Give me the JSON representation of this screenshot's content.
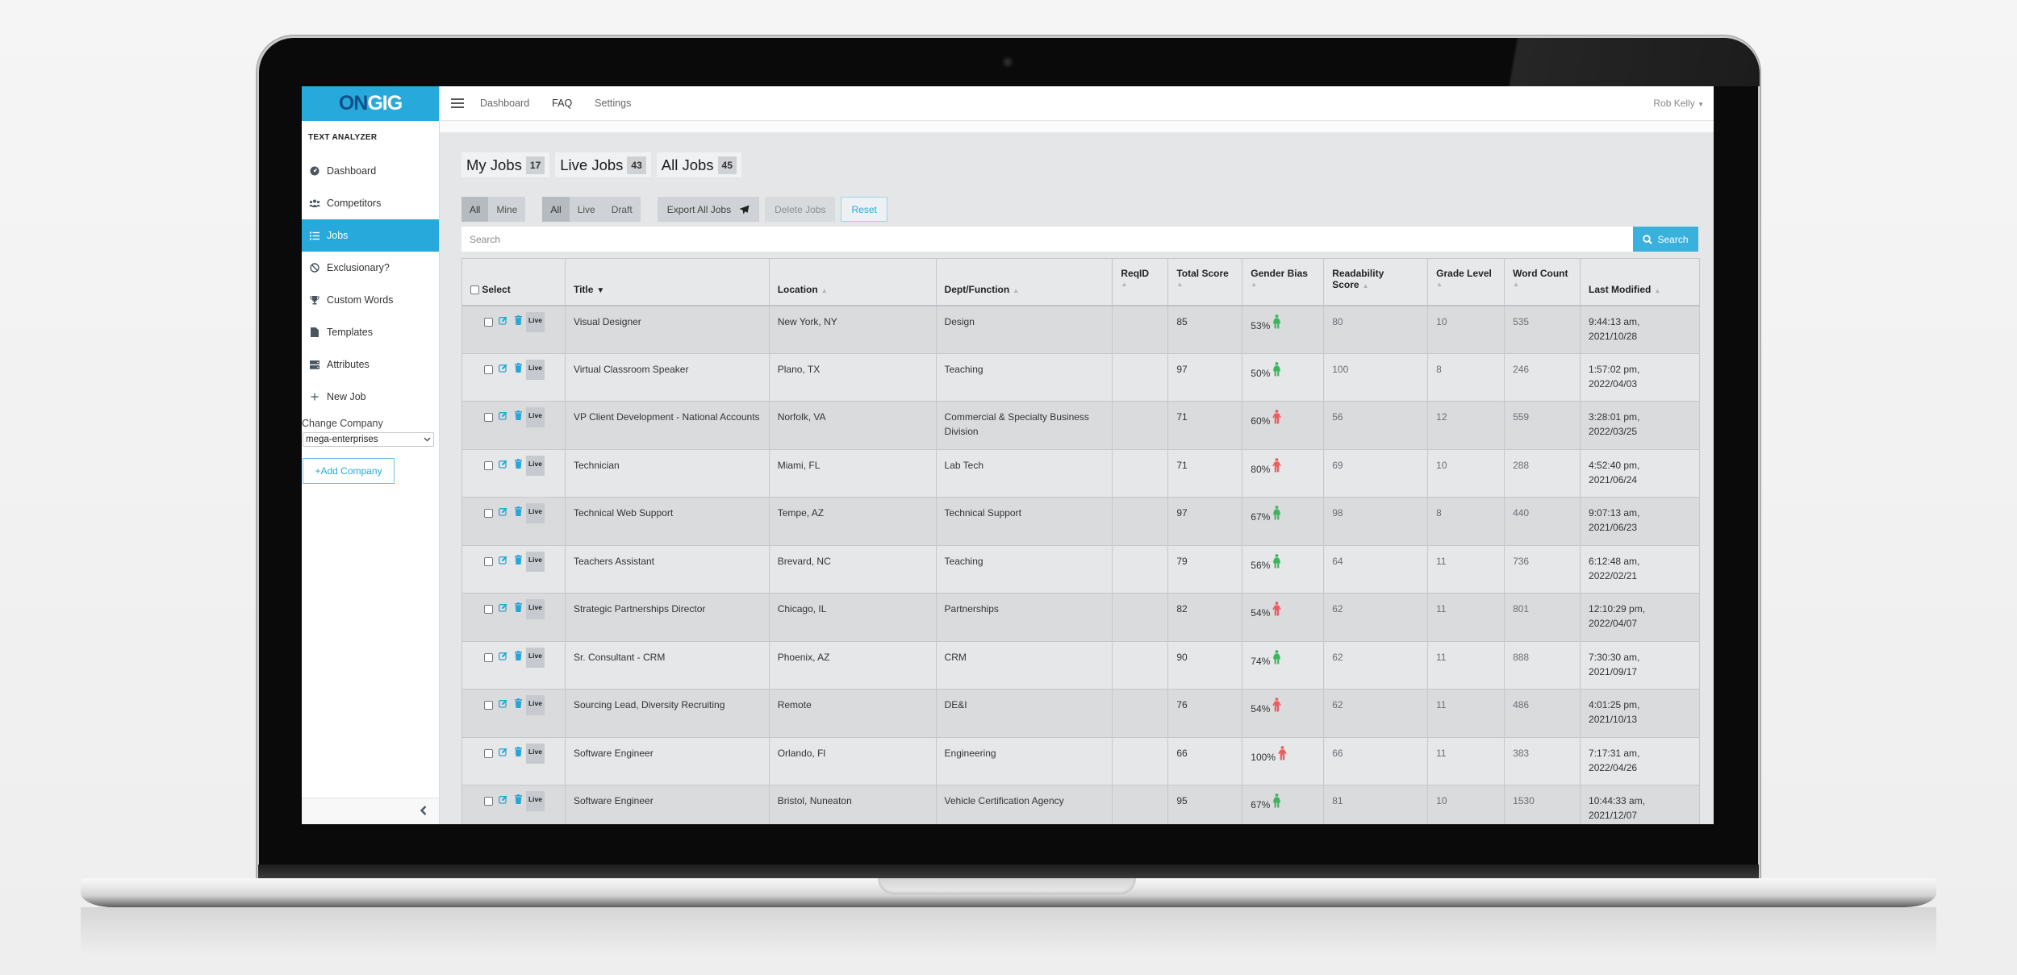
{
  "brand": {
    "logo_part1": "ON",
    "logo_part2": "GIG",
    "primary_color": "#27a9dc",
    "logo_dark": "#12508c"
  },
  "sidebar": {
    "heading": "TEXT ANALYZER",
    "items": [
      {
        "label": "Dashboard",
        "icon": "dashboard-icon",
        "active": false
      },
      {
        "label": "Competitors",
        "icon": "users-icon",
        "active": false
      },
      {
        "label": "Jobs",
        "icon": "list-icon",
        "active": true
      },
      {
        "label": "Exclusionary?",
        "icon": "ban-icon",
        "active": false
      },
      {
        "label": "Custom Words",
        "icon": "trophy-icon",
        "active": false
      },
      {
        "label": "Templates",
        "icon": "file-icon",
        "active": false
      },
      {
        "label": "Attributes",
        "icon": "server-icon",
        "active": false
      },
      {
        "label": "New Job",
        "icon": "plus-icon",
        "active": false
      }
    ],
    "change_company_label": "Change Company",
    "company_selected": "mega-enterprises",
    "add_company_label": "+Add Company",
    "collapse_icon": "chevron-left-icon"
  },
  "topnav": {
    "links": [
      "Dashboard",
      "FAQ",
      "Settings"
    ],
    "user": "Rob Kelly"
  },
  "tabs": [
    {
      "label": "My Jobs",
      "count": "17"
    },
    {
      "label": "Live Jobs",
      "count": "43"
    },
    {
      "label": "All Jobs",
      "count": "45"
    }
  ],
  "filters": {
    "owner": {
      "options": [
        "All",
        "Mine"
      ],
      "selected": "All"
    },
    "status": {
      "options": [
        "All",
        "Live",
        "Draft"
      ],
      "selected": "All"
    },
    "export_label": "Export All Jobs",
    "delete_label": "Delete Jobs",
    "reset_label": "Reset"
  },
  "search": {
    "placeholder": "Search",
    "value": "",
    "button_label": "Search"
  },
  "table": {
    "headers": {
      "select": "Select",
      "title": "Title",
      "location": "Location",
      "dept": "Dept/Function",
      "reqid": "ReqID",
      "total_score": "Total Score",
      "gender_bias": "Gender Bias",
      "readability_1": "Readability",
      "readability_2": "Score",
      "grade_level": "Grade Level",
      "word_count": "Word Count",
      "last_modified": "Last Modified"
    },
    "sorted_by": "Title",
    "status_tag": "Live",
    "rows": [
      {
        "title": "Visual Designer",
        "location": "New York, NY",
        "dept": "Design",
        "reqid": "",
        "total_score": "85",
        "gender_bias": "53%",
        "bias_gender": "female",
        "readability": "80",
        "grade_level": "10",
        "word_count": "535",
        "modified_time": "9:44:13 am,",
        "modified_date": "2021/10/28"
      },
      {
        "title": "Virtual Classroom Speaker",
        "location": "Plano, TX",
        "dept": "Teaching",
        "reqid": "",
        "total_score": "97",
        "gender_bias": "50%",
        "bias_gender": "female",
        "readability": "100",
        "grade_level": "8",
        "word_count": "246",
        "modified_time": "1:57:02 pm,",
        "modified_date": "2022/04/03"
      },
      {
        "title": "VP Client Development - National Accounts",
        "location": "Norfolk, VA",
        "dept": "Commercial & Specialty Business Division",
        "reqid": "",
        "total_score": "71",
        "gender_bias": "60%",
        "bias_gender": "male",
        "readability": "56",
        "grade_level": "12",
        "word_count": "559",
        "modified_time": "3:28:01 pm,",
        "modified_date": "2022/03/25"
      },
      {
        "title": "Technician",
        "location": "Miami, FL",
        "dept": "Lab Tech",
        "reqid": "",
        "total_score": "71",
        "gender_bias": "80%",
        "bias_gender": "male",
        "readability": "69",
        "grade_level": "10",
        "word_count": "288",
        "modified_time": "4:52:40 pm,",
        "modified_date": "2021/06/24"
      },
      {
        "title": "Technical Web Support",
        "location": "Tempe, AZ",
        "dept": "Technical Support",
        "reqid": "",
        "total_score": "97",
        "gender_bias": "67%",
        "bias_gender": "female",
        "readability": "98",
        "grade_level": "8",
        "word_count": "440",
        "modified_time": "9:07:13 am,",
        "modified_date": "2021/06/23"
      },
      {
        "title": "Teachers Assistant",
        "location": "Brevard, NC",
        "dept": "Teaching",
        "reqid": "",
        "total_score": "79",
        "gender_bias": "56%",
        "bias_gender": "female",
        "readability": "64",
        "grade_level": "11",
        "word_count": "736",
        "modified_time": "6:12:48 am,",
        "modified_date": "2022/02/21"
      },
      {
        "title": "Strategic Partnerships Director",
        "location": "Chicago, IL",
        "dept": "Partnerships",
        "reqid": "",
        "total_score": "82",
        "gender_bias": "54%",
        "bias_gender": "male",
        "readability": "62",
        "grade_level": "11",
        "word_count": "801",
        "modified_time": "12:10:29 pm,",
        "modified_date": "2022/04/07"
      },
      {
        "title": "Sr. Consultant - CRM",
        "location": "Phoenix, AZ",
        "dept": "CRM",
        "reqid": "",
        "total_score": "90",
        "gender_bias": "74%",
        "bias_gender": "female",
        "readability": "62",
        "grade_level": "11",
        "word_count": "888",
        "modified_time": "7:30:30 am,",
        "modified_date": "2021/09/17"
      },
      {
        "title": "Sourcing Lead, Diversity Recruiting",
        "location": "Remote",
        "dept": "DE&I",
        "reqid": "",
        "total_score": "76",
        "gender_bias": "54%",
        "bias_gender": "male",
        "readability": "62",
        "grade_level": "11",
        "word_count": "486",
        "modified_time": "4:01:25 pm,",
        "modified_date": "2021/10/13"
      },
      {
        "title": "Software Engineer",
        "location": "Orlando, Fl",
        "dept": "Engineering",
        "reqid": "",
        "total_score": "66",
        "gender_bias": "100%",
        "bias_gender": "male",
        "readability": "66",
        "grade_level": "11",
        "word_count": "383",
        "modified_time": "7:17:31 am,",
        "modified_date": "2022/04/26"
      },
      {
        "title": "Software Engineer",
        "location": "Bristol, Nuneaton",
        "dept": "Vehicle Certification Agency",
        "reqid": "",
        "total_score": "95",
        "gender_bias": "67%",
        "bias_gender": "female",
        "readability": "81",
        "grade_level": "10",
        "word_count": "1530",
        "modified_time": "10:44:33 am,",
        "modified_date": "2021/12/07"
      }
    ],
    "bias_colors": {
      "female": "#3fb45f",
      "male": "#ee5c5c"
    }
  }
}
